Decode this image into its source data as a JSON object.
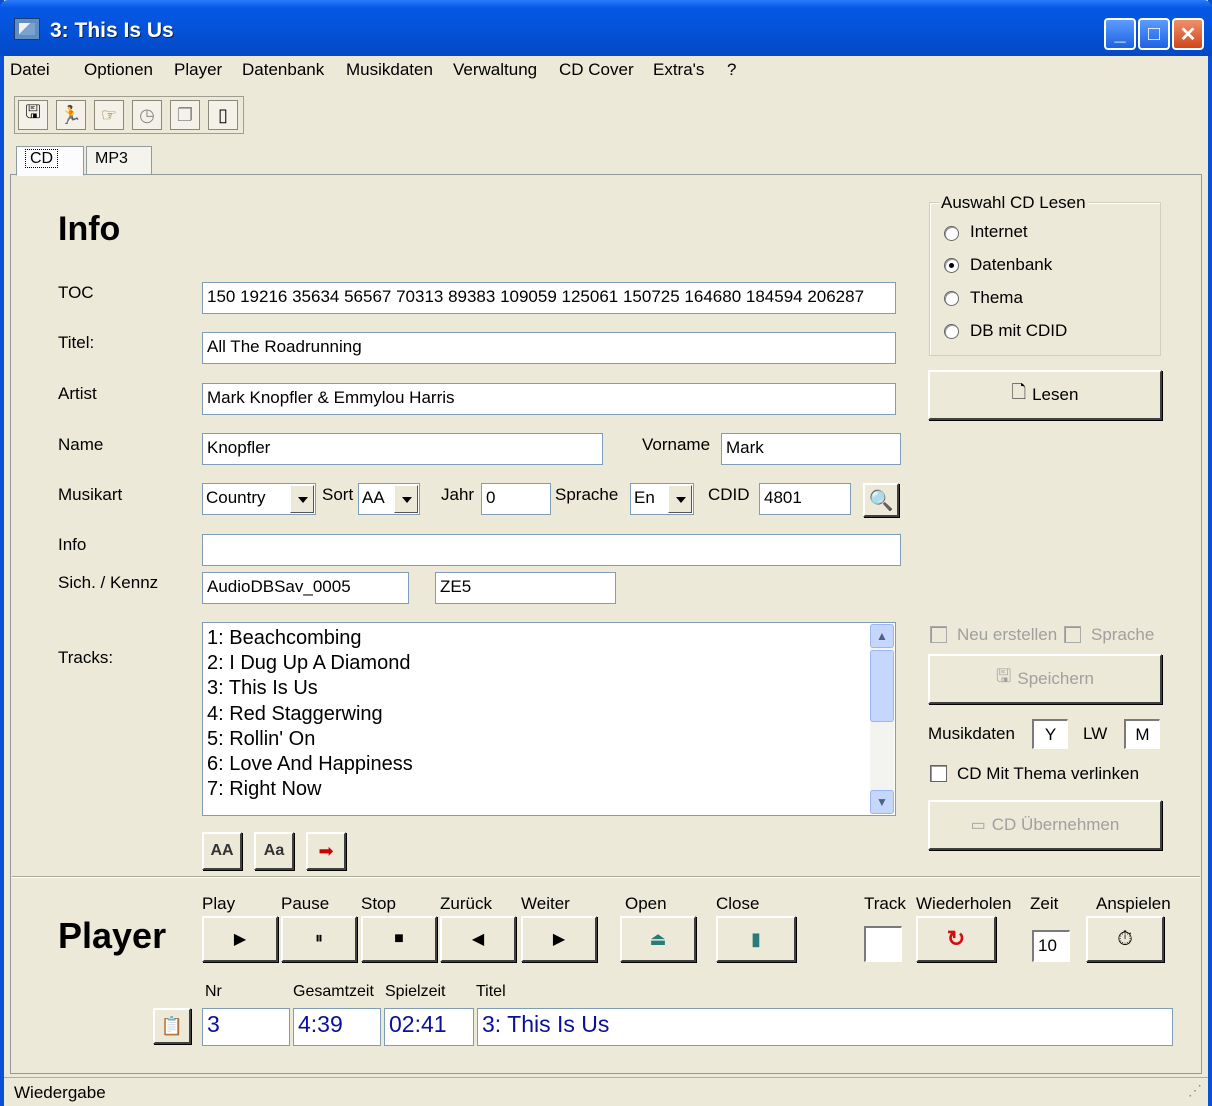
{
  "window": {
    "title": "3: This Is Us"
  },
  "menu": [
    "Datei",
    "Optionen",
    "Player",
    "Datenbank",
    "Musikdaten",
    "Verwaltung",
    "CD Cover",
    "Extra's",
    "?"
  ],
  "toolbar": {
    "icons": [
      "save-disk-icon",
      "run-icon",
      "hand-pointer-icon",
      "clock-icon",
      "copy-pages-icon",
      "device-icon"
    ]
  },
  "tabs": [
    "CD",
    "MP3"
  ],
  "info": {
    "heading": "Info",
    "toc_label": "TOC",
    "toc": "150 19216 35634 56567 70313 89383 109059 125061 150725 164680 184594 206287",
    "titel_label": "Titel:",
    "titel": "All The Roadrunning",
    "artist_label": "Artist",
    "artist": "Mark Knopfler & Emmylou Harris",
    "name_label": "Name",
    "name": "Knopfler",
    "vorname_label": "Vorname",
    "vorname": "Mark",
    "musikart_label": "Musikart",
    "musikart": "Country",
    "sort_label": "Sort",
    "sort": "AA",
    "jahr_label": "Jahr",
    "jahr": "0",
    "sprache_label": "Sprache",
    "sprache": "En",
    "cdid_label": "CDID",
    "cdid": "4801",
    "info_label": "Info",
    "info_value": "",
    "sich_label": "Sich. / Kennz",
    "sich": "AudioDBSav_0005",
    "kennz": "ZE5",
    "tracks_label": "Tracks:",
    "tracks": [
      "1: Beachcombing",
      "2: I Dug Up A Diamond",
      "3: This Is Us",
      "4: Red Staggerwing",
      "5: Rollin' On",
      "6: Love And Happiness",
      "7: Right Now"
    ]
  },
  "auswahl": {
    "title": "Auswahl CD Lesen",
    "options": [
      "Internet",
      "Datenbank",
      "Thema",
      "DB mit CDID"
    ],
    "selected": "Datenbank",
    "lesen_label": "Lesen"
  },
  "right": {
    "neu_erstellen": "Neu erstellen",
    "sprache": "Sprache",
    "speichern": "Speichern",
    "musikdaten_label": "Musikdaten",
    "musikdaten_value": "Y",
    "lw_label": "LW",
    "lw_value": "M",
    "cd_thema": "CD Mit Thema verlinken",
    "cd_uebernehmen": "CD Übernehmen"
  },
  "player": {
    "heading": "Player",
    "buttons": [
      "Play",
      "Pause",
      "Stop",
      "Zurück",
      "Weiter",
      "Open",
      "Close"
    ],
    "track_label": "Track",
    "wiederholen_label": "Wiederholen",
    "zeit_label": "Zeit",
    "zeit_value": "10",
    "anspielen_label": "Anspielen",
    "nr_label": "Nr",
    "gesamtzeit_label": "Gesamtzeit",
    "spielzeit_label": "Spielzeit",
    "titel_label": "Titel",
    "nr": "3",
    "gesamtzeit": "4:39",
    "spielzeit": "02:41",
    "titel": "3: This Is Us"
  },
  "status": "Wiedergabe"
}
